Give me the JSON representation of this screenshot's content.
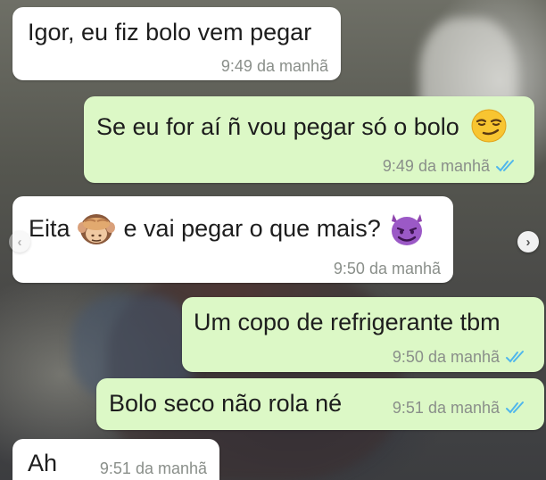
{
  "messages": [
    {
      "direction": "incoming",
      "text": "Igor, eu fiz bolo vem pegar",
      "time": "9:49 da manhã"
    },
    {
      "direction": "outgoing",
      "text": "Se eu for aí ñ vou pegar só o bolo",
      "emoji": "smirking-face-icon",
      "time": "9:49 da manhã",
      "status": "read"
    },
    {
      "direction": "incoming",
      "text_before": "Eita",
      "emoji_1": "see-no-evil-monkey-icon",
      "text_after": "e vai pegar o que mais?",
      "emoji_2": "smiling-devil-icon",
      "time": "9:50 da manhã"
    },
    {
      "direction": "outgoing",
      "text": "Um copo de refrigerante tbm",
      "time": "9:50 da manhã",
      "status": "read"
    },
    {
      "direction": "outgoing",
      "text": "Bolo seco não rola né",
      "time": "9:51 da manhã",
      "status": "read"
    },
    {
      "direction": "incoming",
      "text": "Ah",
      "time": "9:51 da manhã"
    }
  ],
  "carousel": {
    "prev_icon": "chevron-left-icon",
    "next_icon": "chevron-right-icon",
    "prev_glyph": "‹",
    "next_glyph": "›"
  },
  "colors": {
    "incoming_bubble": "#ffffff",
    "outgoing_bubble": "#dcf8c6",
    "read_ticks": "#4fb6ec",
    "meta_text": "#8a8f8a"
  }
}
